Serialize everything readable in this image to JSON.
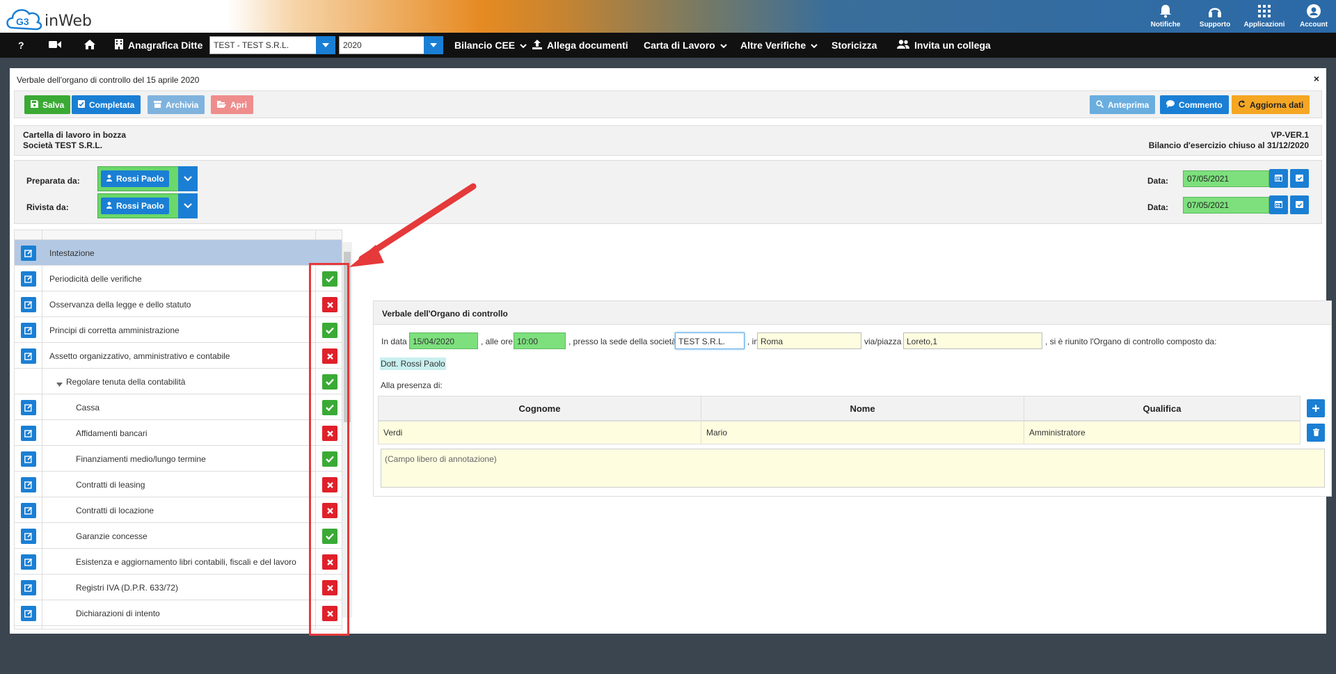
{
  "header": {
    "logo_text": "inWeb",
    "logo_mark": "G3",
    "items": [
      {
        "label": "Notifiche",
        "icon": "bell-icon"
      },
      {
        "label": "Supporto",
        "icon": "headset-icon"
      },
      {
        "label": "Applicazioni",
        "icon": "grid-icon"
      },
      {
        "label": "Account",
        "icon": "user-circle-icon"
      }
    ]
  },
  "menubar": {
    "help": "?",
    "anagrafica": "Anagrafica Ditte",
    "company_value": "TEST - TEST S.R.L.",
    "year_value": "2020",
    "bilancio": "Bilancio CEE",
    "allega": "Allega documenti",
    "carta": "Carta di Lavoro",
    "altre": "Altre Verifiche",
    "storicizza": "Storicizza",
    "invita": "Invita un collega"
  },
  "panel": {
    "title": "Verbale dell'organo di controllo del 15 aprile 2020",
    "close": "×"
  },
  "toolbar": {
    "salva": "Salva",
    "completata": "Completata",
    "archivia": "Archivia",
    "apri": "Apri",
    "anteprima": "Anteprima",
    "commento": "Commento",
    "aggiorna": "Aggiorna dati",
    "colors": {
      "green": "#3aaa35",
      "blue": "#1a7fd4",
      "light_blue": "#7fb3de",
      "light_red": "#ef8d8d",
      "sky": "#6aaee0",
      "orange": "#f5a623"
    }
  },
  "info": {
    "status": "Cartella di lavoro in bozza",
    "company": "Società TEST S.R.L.",
    "code": "VP-VER.1",
    "bilancio": "Bilancio d'esercizio chiuso al 31/12/2020"
  },
  "prep": {
    "preparata_label": "Preparata da:",
    "rivista_label": "Rivista da:",
    "preparata_person": "Rossi Paolo",
    "rivista_person": "Rossi Paolo",
    "data_label": "Data:",
    "preparata_date": "07/05/2021",
    "rivista_date": "07/05/2021"
  },
  "tree": {
    "rows": [
      {
        "label": "Intestazione",
        "status": "none",
        "editable": true
      },
      {
        "label": "Periodicità delle verifiche",
        "status": "ok",
        "editable": true
      },
      {
        "label": "Osservanza della legge e dello statuto",
        "status": "ko",
        "editable": true
      },
      {
        "label": "Principi di corretta amministrazione",
        "status": "ok",
        "editable": true
      },
      {
        "label": "Assetto organizzativo, amministrativo e contabile",
        "status": "ko",
        "editable": true
      },
      {
        "label": "Regolare tenuta della contabilità",
        "status": "ok",
        "editable": false
      },
      {
        "label": "Cassa",
        "status": "ok",
        "editable": true
      },
      {
        "label": "Affidamenti bancari",
        "status": "ko",
        "editable": true
      },
      {
        "label": "Finanziamenti medio/lungo termine",
        "status": "ok",
        "editable": true
      },
      {
        "label": "Contratti di leasing",
        "status": "ko",
        "editable": true
      },
      {
        "label": "Contratti di locazione",
        "status": "ko",
        "editable": true
      },
      {
        "label": "Garanzie concesse",
        "status": "ok",
        "editable": true
      },
      {
        "label": "Esistenza e aggiornamento libri contabili, fiscali e del lavoro",
        "status": "ko",
        "editable": true
      },
      {
        "label": "Registri IVA (D.P.R. 633/72)",
        "status": "ko",
        "editable": true
      },
      {
        "label": "Dichiarazioni di intento",
        "status": "ko",
        "editable": true
      }
    ]
  },
  "form": {
    "title": "Verbale dell'Organo di controllo",
    "in_data": "In data",
    "date": "15/04/2020",
    "alle_ore": ", alle ore",
    "time": "10:00",
    "presso": ", presso la sede della società",
    "company": "TEST S.R.L.",
    "in": ", in",
    "city": "Roma",
    "via_label": "via/piazza",
    "via": "Loreto,1",
    "riunito": ", si è riunito l'Organo di controllo composto da:",
    "member": "Dott. Rossi Paolo",
    "alla_presenza": "Alla presenza di:",
    "columns": [
      "Cognome",
      "Nome",
      "Qualifica"
    ],
    "row": {
      "cognome": "Verdi",
      "nome": "Mario",
      "qualifica": "Amministratore"
    },
    "notes_placeholder": "(Campo libero di annotazione)"
  }
}
